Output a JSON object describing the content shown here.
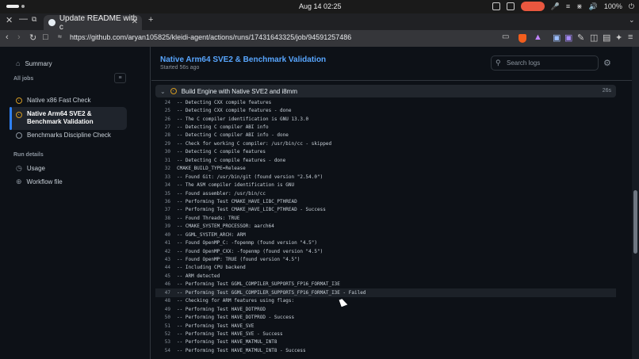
{
  "system": {
    "clock": "Aug 14  02:25",
    "battery": "100%"
  },
  "browser": {
    "tab_title": "Update README with c",
    "url": "https://github.com/aryan105825/kleidi-agent/actions/runs/17431643325/job/94591257486"
  },
  "sidebar": {
    "summary": "Summary",
    "all_jobs": "All jobs",
    "jobs": [
      {
        "label": "Native x86 Fast Check",
        "status": "in-progress"
      },
      {
        "label": "Native Arm64 SVE2 & Benchmark Validation",
        "status": "in-progress"
      },
      {
        "label": "Benchmarks Discipline Check",
        "status": "skipped"
      }
    ],
    "run_details": "Run details",
    "usage": "Usage",
    "workflow_file": "Workflow file"
  },
  "main": {
    "title": "Native Arm64 SVE2 & Benchmark Validation",
    "started": "Started 56s ago",
    "search_placeholder": "Search logs",
    "step_name": "Build Engine with Native SVE2 and i8mm",
    "step_duration": "26s"
  },
  "log": [
    {
      "n": "24",
      "t": "-- Detecting CXX compile features"
    },
    {
      "n": "25",
      "t": "-- Detecting CXX compile features - done"
    },
    {
      "n": "26",
      "t": "-- The C compiler identification is GNU 13.3.0"
    },
    {
      "n": "27",
      "t": "-- Detecting C compiler ABI info"
    },
    {
      "n": "28",
      "t": "-- Detecting C compiler ABI info - done"
    },
    {
      "n": "29",
      "t": "-- Check for working C compiler: /usr/bin/cc - skipped"
    },
    {
      "n": "30",
      "t": "-- Detecting C compile features"
    },
    {
      "n": "31",
      "t": "-- Detecting C compile features - done"
    },
    {
      "n": "32",
      "t": "CMAKE_BUILD_TYPE=Release"
    },
    {
      "n": "33",
      "t": "-- Found Git: /usr/bin/git (found version \"2.54.0\")"
    },
    {
      "n": "34",
      "t": "-- The ASM compiler identification is GNU"
    },
    {
      "n": "35",
      "t": "-- Found assembler: /usr/bin/cc"
    },
    {
      "n": "36",
      "t": "-- Performing Test CMAKE_HAVE_LIBC_PTHREAD"
    },
    {
      "n": "37",
      "t": "-- Performing Test CMAKE_HAVE_LIBC_PTHREAD - Success"
    },
    {
      "n": "38",
      "t": "-- Found Threads: TRUE"
    },
    {
      "n": "39",
      "t": "-- CMAKE_SYSTEM_PROCESSOR: aarch64"
    },
    {
      "n": "40",
      "t": "-- GGML_SYSTEM_ARCH: ARM"
    },
    {
      "n": "41",
      "t": "-- Found OpenMP_C: -fopenmp (found version \"4.5\")"
    },
    {
      "n": "42",
      "t": "-- Found OpenMP_CXX: -fopenmp (found version \"4.5\")"
    },
    {
      "n": "43",
      "t": "-- Found OpenMP: TRUE (found version \"4.5\")"
    },
    {
      "n": "44",
      "t": "-- Including CPU backend"
    },
    {
      "n": "45",
      "t": "-- ARM detected"
    },
    {
      "n": "46",
      "t": "-- Performing Test GGML_COMPILER_SUPPORTS_FP16_FORMAT_I3E"
    },
    {
      "n": "47",
      "t": "-- Performing Test GGML_COMPILER_SUPPORTS_FP16_FORMAT_I3E - Failed"
    },
    {
      "n": "48",
      "t": "-- Checking for ARM features using flags:"
    },
    {
      "n": "49",
      "t": "-- Performing Test HAVE_DOTPROD"
    },
    {
      "n": "50",
      "t": "-- Performing Test HAVE_DOTPROD - Success"
    },
    {
      "n": "51",
      "t": "-- Performing Test HAVE_SVE"
    },
    {
      "n": "52",
      "t": "-- Performing Test HAVE_SVE - Success"
    },
    {
      "n": "53",
      "t": "-- Performing Test HAVE_MATMUL_INT8"
    },
    {
      "n": "54",
      "t": "-- Performing Test HAVE_MATMUL_INT8 - Success"
    }
  ]
}
